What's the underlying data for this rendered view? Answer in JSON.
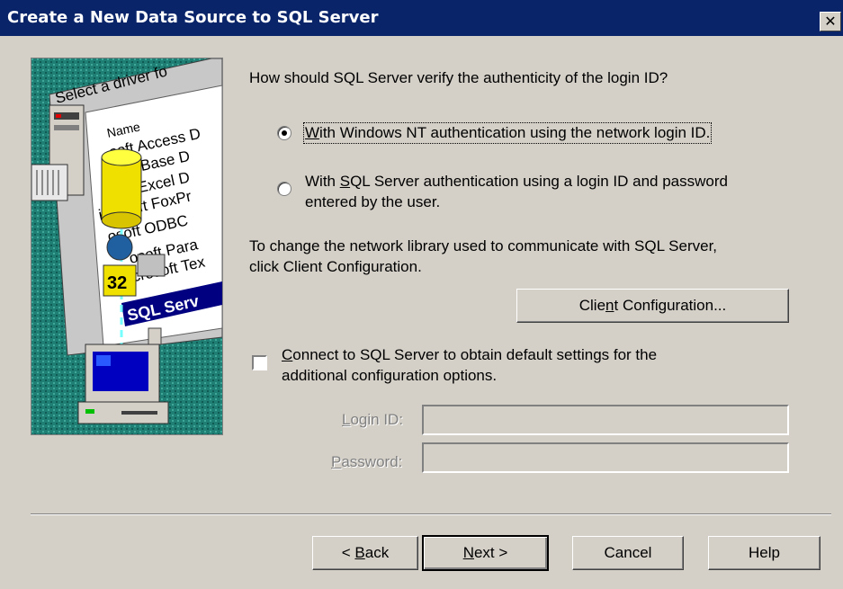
{
  "window": {
    "title": "Create a New Data Source to SQL Server",
    "close_glyph": "✕"
  },
  "illustration": {
    "icon": "odbc-wizard-illustration",
    "list_items": [
      "Select a driver fo",
      "Name",
      "soft Access D",
      "oft dBase D",
      "soft Excel D",
      "icrosoft FoxPr",
      "osoft ODBC",
      "osoft Para",
      "Microsoft Tex",
      "SQL Serv"
    ],
    "badge": "32"
  },
  "question": "How should SQL Server verify the authenticity of the login ID?",
  "auth_options": [
    {
      "pre": "",
      "key": "W",
      "post": "ith Windows NT authentication using the network login ID.",
      "checked": true
    },
    {
      "pre": "With ",
      "key": "S",
      "post": "QL Server authentication using a login ID and password",
      "line2": "entered by the user.",
      "checked": false
    }
  ],
  "network_text": {
    "line1": "To change the network library used to communicate with SQL Server,",
    "line2": "click Client Configuration."
  },
  "client_config_button": {
    "pre": "Clie",
    "key": "n",
    "post": "t Configuration..."
  },
  "connect_checkbox": {
    "key": "C",
    "post": "onnect to SQL Server to obtain default settings for the",
    "line2": "additional configuration options.",
    "checked": false
  },
  "login": {
    "login_label_pre": "",
    "login_label_key": "L",
    "login_label_post": "ogin ID:",
    "password_label_pre": "",
    "password_label_key": "P",
    "password_label_post": "assword:",
    "login_value": "",
    "password_value": ""
  },
  "buttons": {
    "back_pre": "< ",
    "back_key": "B",
    "back_post": "ack",
    "next_key": "N",
    "next_post": "ext >",
    "cancel": "Cancel",
    "help": "Help"
  }
}
